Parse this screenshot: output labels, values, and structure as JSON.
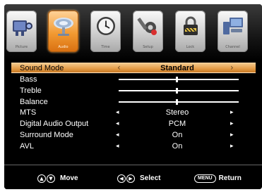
{
  "tabs": [
    {
      "id": "picture",
      "label": "Picture",
      "icon": "camera-icon",
      "active": false
    },
    {
      "id": "audio",
      "label": "Audio",
      "icon": "satellite-dish-icon",
      "active": true
    },
    {
      "id": "time",
      "label": "Time",
      "icon": "clock-icon",
      "active": false
    },
    {
      "id": "setup",
      "label": "Setup",
      "icon": "wrench-gear-icon",
      "active": false
    },
    {
      "id": "lock",
      "label": "Lock",
      "icon": "padlock-icon",
      "active": false
    },
    {
      "id": "channel",
      "label": "Channel",
      "icon": "computer-icon",
      "active": false
    }
  ],
  "menu": {
    "sound_mode": {
      "label": "Sound Mode",
      "value": "Standard"
    },
    "bass": {
      "label": "Bass",
      "level": 0.48
    },
    "treble": {
      "label": "Treble",
      "level": 0.48
    },
    "balance": {
      "label": "Balance",
      "level": 0.48
    },
    "mts": {
      "label": "MTS",
      "value": "Stereo"
    },
    "digital_audio_output": {
      "label": "Digital Audio Output",
      "value": "PCM"
    },
    "surround_mode": {
      "label": "Surround Mode",
      "value": "On"
    },
    "avl": {
      "label": "AVL",
      "value": "On"
    }
  },
  "footer": {
    "move_label": "Move",
    "select_label": "Select",
    "menu_key": "MENU",
    "return_label": "Return"
  },
  "colors": {
    "accent": "#e39a45",
    "background": "#000000",
    "text": "#ffffff"
  }
}
